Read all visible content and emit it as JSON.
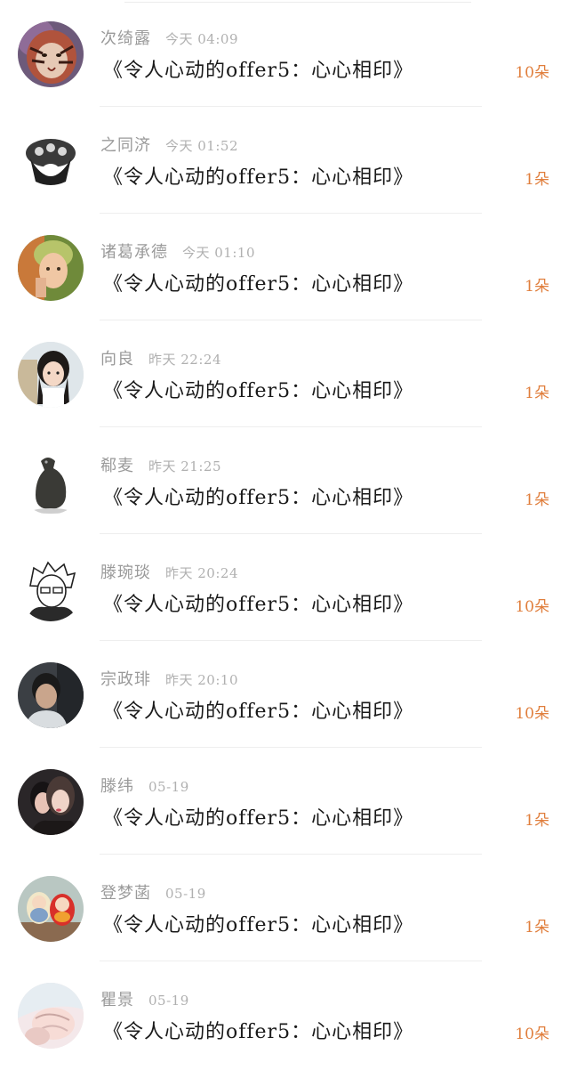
{
  "rows": [
    {
      "name": "次绮露",
      "time": "今天 04:09",
      "title": "《令人心动的offer5：心心相印》",
      "count": "10朵",
      "avatar": "tiger-avatar"
    },
    {
      "name": "之同济",
      "time": "今天 01:52",
      "title": "《令人心动的offer5：心心相印》",
      "count": "1朵",
      "avatar": "ring-avatar"
    },
    {
      "name": "诸葛承德",
      "time": "今天 01:10",
      "title": "《令人心动的offer5：心心相印》",
      "count": "1朵",
      "avatar": "person-avatar"
    },
    {
      "name": "向良",
      "time": "昨天 22:24",
      "title": "《令人心动的offer5：心心相印》",
      "count": "1朵",
      "avatar": "girl-avatar"
    },
    {
      "name": "郗麦",
      "time": "昨天 21:25",
      "title": "《令人心动的offer5：心心相印》",
      "count": "1朵",
      "avatar": "bird-statue-avatar"
    },
    {
      "name": "滕琬琰",
      "time": "昨天 20:24",
      "title": "《令人心动的offer5：心心相印》",
      "count": "10朵",
      "avatar": "anime-avatar"
    },
    {
      "name": "宗政琲",
      "time": "昨天 20:10",
      "title": "《令人心动的offer5：心心相印》",
      "count": "10朵",
      "avatar": "man-avatar"
    },
    {
      "name": "滕纬",
      "time": "05-19",
      "title": "《令人心动的offer5：心心相印》",
      "count": "1朵",
      "avatar": "couple-avatar"
    },
    {
      "name": "登梦菡",
      "time": "05-19",
      "title": "《令人心动的offer5：心心相印》",
      "count": "1朵",
      "avatar": "dolls-avatar"
    },
    {
      "name": "瞿景",
      "time": "05-19",
      "title": "《令人心动的offer5：心心相印》",
      "count": "10朵",
      "avatar": "illustration-avatar"
    }
  ],
  "colors": {
    "name": "#9a9a9a",
    "time": "#b0b0b0",
    "title": "#1a1a1a",
    "count": "#e07e3c",
    "divider": "#eeeeee"
  }
}
